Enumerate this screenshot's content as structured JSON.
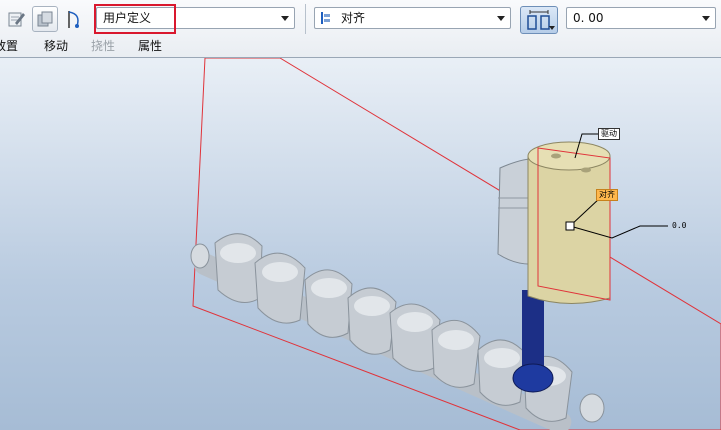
{
  "toolbar": {
    "edit_icon": "edit-icon",
    "copy_icon": "copy-icon",
    "curve_icon": "curve-icon",
    "constraint_combo": {
      "value": "用户定义"
    },
    "align_icon": "align-icon",
    "align_combo": {
      "value": "对齐"
    },
    "offset_toggle_icon": "offset-icon",
    "offset_field": {
      "value": "0. 00"
    },
    "highlight_color": "#d9182e"
  },
  "menu": {
    "items": [
      {
        "label": "放置",
        "enabled": true
      },
      {
        "label": "移动",
        "enabled": true
      },
      {
        "label": "挠性",
        "enabled": false
      },
      {
        "label": "属性",
        "enabled": true
      }
    ]
  },
  "viewport": {
    "labels": {
      "top_tag": "驱动",
      "align_tag": "对齐",
      "offset_value": "0.0"
    },
    "colors": {
      "plane": "#e0333a",
      "crank": "#c6ccd3",
      "piston": "#dcd4a4",
      "rod": "#1c2f86"
    }
  }
}
